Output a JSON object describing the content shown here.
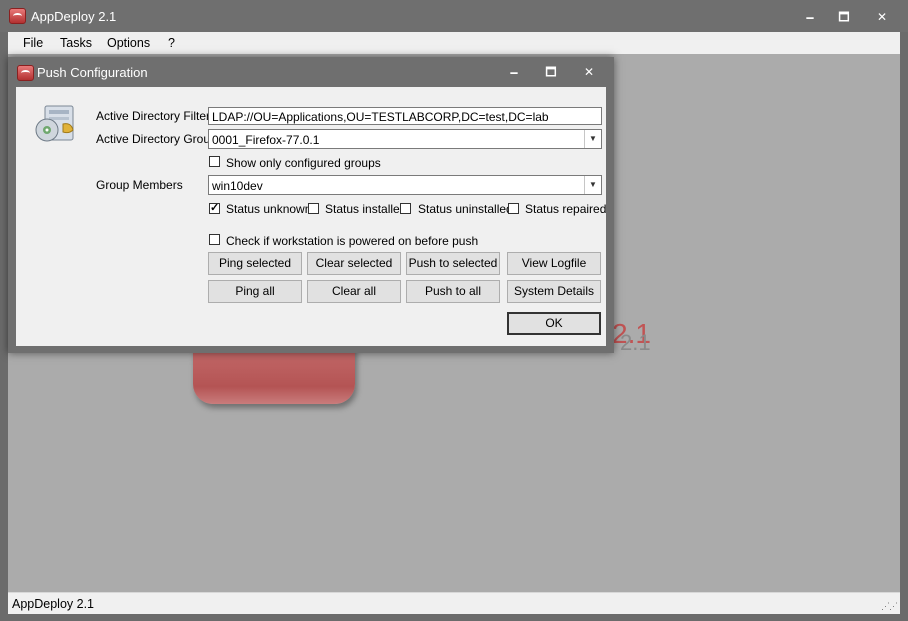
{
  "app": {
    "title": "AppDeploy 2.1",
    "controls": {
      "minimize": "🗕",
      "maximize": "🗖",
      "close": "✕"
    },
    "menu": [
      {
        "label": "File"
      },
      {
        "label": "Tasks"
      },
      {
        "label": "Options"
      },
      {
        "label": "?"
      }
    ],
    "background_logo_text": "2.1",
    "background_logo_text_small": "2.1",
    "status": "AppDeploy 2.1",
    "grip": "⋰⋰"
  },
  "dialog": {
    "title": "Push Configuration",
    "ad_filter_label": "Active Directory Filter",
    "ad_filter_value": "LDAP://OU=Applications,OU=TESTLABCORP,DC=test,DC=lab",
    "ad_group_label": "Active Directory Group",
    "ad_group_value": "0001_Firefox-77.0.1",
    "show_configured_label": "Show only configured groups",
    "group_members_label": "Group Members",
    "group_members_value": "win10dev",
    "status_filters": [
      {
        "label": "Status unknown",
        "checked": true
      },
      {
        "label": "Status installed",
        "checked": false
      },
      {
        "label": "Status uninstalled",
        "checked": false
      },
      {
        "label": "Status repaired",
        "checked": false
      }
    ],
    "check_powered_label": "Check if workstation is powered on before push",
    "buttons_row1": [
      "Ping selected",
      "Clear selected",
      "Push to selected",
      "View Logfile"
    ],
    "buttons_row2": [
      "Ping all",
      "Clear all",
      "Push to all",
      "System Details"
    ],
    "ok_label": "OK",
    "icon": "installer-package-icon"
  }
}
